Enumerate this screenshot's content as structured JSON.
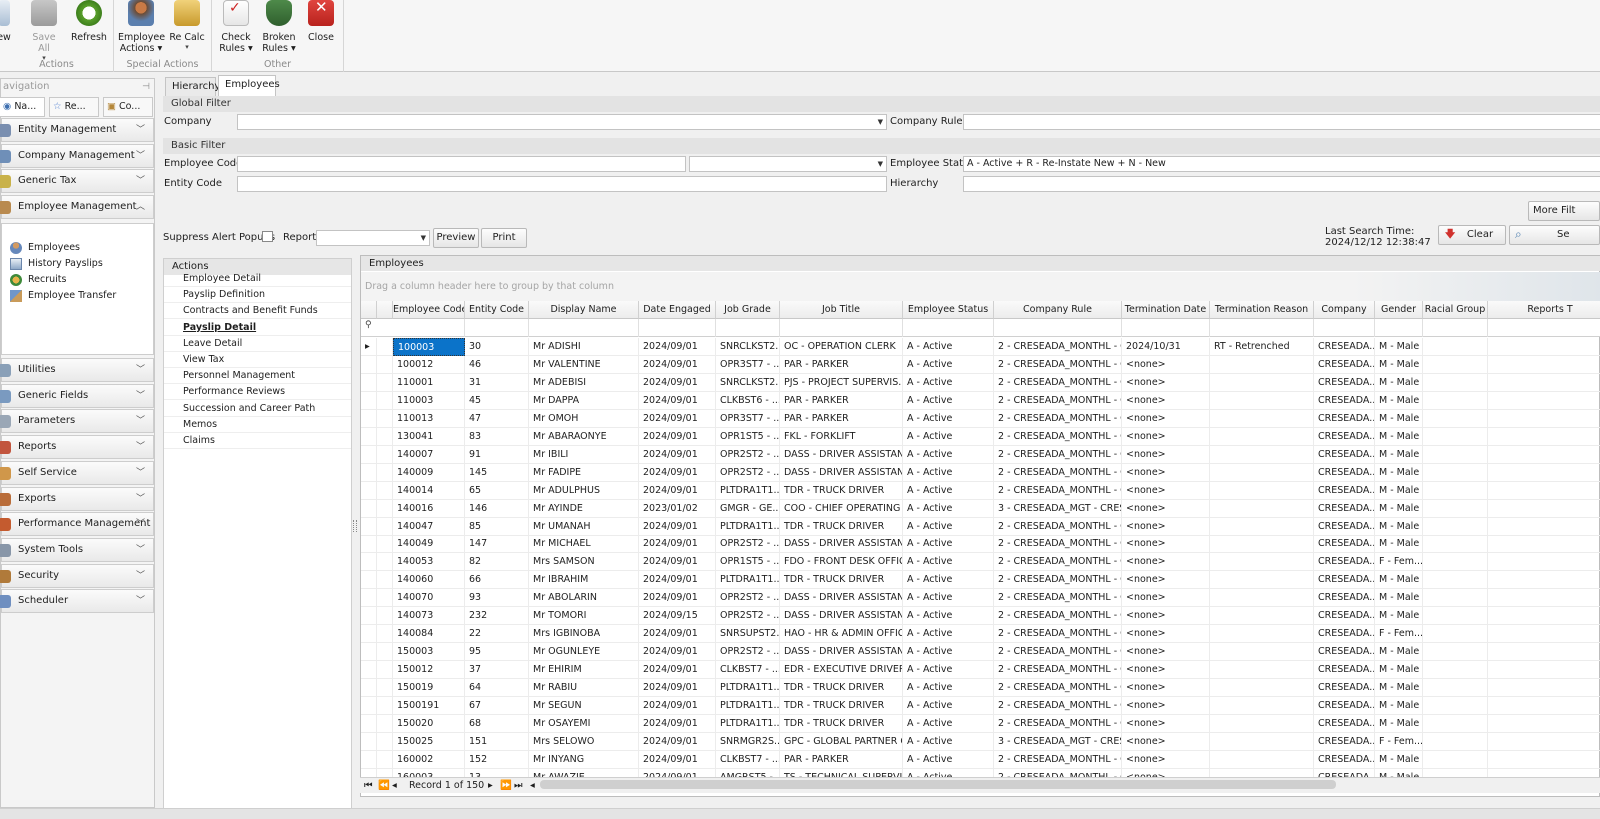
{
  "ribbon": {
    "groups": [
      {
        "caption": "Actions",
        "buttons": [
          {
            "label": "ew",
            "enabled": true
          },
          {
            "label": "Save All",
            "enabled": false
          },
          {
            "label": "Refresh",
            "enabled": true
          }
        ]
      },
      {
        "caption": "Special Actions",
        "buttons": [
          {
            "label": "Employee",
            "label2": "Actions",
            "dropdown": true
          },
          {
            "label": "Re Calc",
            "dropdown": true
          }
        ]
      },
      {
        "caption": "Other",
        "buttons": [
          {
            "label": "Check",
            "label2": "Rules",
            "dropdown": true
          },
          {
            "label": "Broken",
            "label2": "Rules",
            "dropdown": true
          },
          {
            "label": "Close"
          }
        ]
      }
    ]
  },
  "nav": {
    "title": "avigation",
    "pin": "ᵖ",
    "tabs": [
      "Na...",
      "Re...",
      "Co..."
    ],
    "sections_top": [
      "Entity Management",
      "Company Management",
      "Generic Tax",
      "Employee Management"
    ],
    "tree": [
      "Employees",
      "History Payslips",
      "Recruits",
      "Employee Transfer"
    ],
    "sections_bottom": [
      "Utilities",
      "Generic Fields",
      "Parameters",
      "Reports",
      "Self Service",
      "Exports",
      "Performance Management",
      "System Tools",
      "Security",
      "Scheduler"
    ]
  },
  "tabs": [
    "Hierarchy",
    "Employees"
  ],
  "filters": {
    "global_title": "Global Filter",
    "company_label": "Company",
    "company_rule_label": "Company Rule",
    "basic_title": "Basic Filter",
    "employee_code_label": "Employee Code",
    "employee_status_label": "Employee Status",
    "employee_status_value": "A - Active + R - Re-Instate New + N - New",
    "entity_code_label": "Entity Code",
    "hierarchy_label": "Hierarchy",
    "more_filters": "More Filt",
    "suppress_label": "Suppress Alert Popups",
    "report_label": "Report",
    "preview": "Preview",
    "print": "Print",
    "last_search_label": "Last Search Time:",
    "last_search_value": "2024/12/12 12:38:47",
    "clear": "Clear",
    "search": "Se"
  },
  "actions": {
    "title": "Actions",
    "items": [
      "Employee Detail",
      "Payslip Definition",
      "Contracts and Benefit Funds",
      "Payslip Detail",
      "Leave Detail",
      "View Tax",
      "Personnel Management",
      "Performance Reviews",
      "Succession and Career Path",
      "Memos",
      "Claims"
    ],
    "bold_index": 3
  },
  "grid": {
    "title": "Employees",
    "group_hint": "Drag a column header here to group by that column",
    "columns": [
      "Employee Code",
      "Entity Code",
      "Display Name",
      "Date Engaged",
      "Job Grade",
      "Job Title",
      "Employee Status",
      "Company Rule",
      "Termination Date",
      "Termination Reason",
      "Company",
      "Gender",
      "Racial Group",
      "Reports T"
    ],
    "rows": [
      [
        "100003",
        "30",
        "Mr ADISHI",
        "2024/09/01",
        "SNRCLKST2...",
        "OC - OPERATION CLERK",
        "A - Active",
        "2 - CRESEADA_MONTHL - C...",
        "2024/10/31",
        "RT - Retrenched",
        "CRESEADA...",
        "M - Male",
        "",
        ""
      ],
      [
        "100012",
        "46",
        "Mr VALENTINE",
        "2024/09/01",
        "OPR3ST7 - ...",
        "PAR - PARKER",
        "A - Active",
        "2 - CRESEADA_MONTHL - C...",
        "<none>",
        "",
        "CRESEADA...",
        "M - Male",
        "",
        ""
      ],
      [
        "110001",
        "31",
        "Mr ADEBISI",
        "2024/09/01",
        "SNRCLKST2...",
        "PJS - PROJECT SUPERVIS...",
        "A - Active",
        "2 - CRESEADA_MONTHL - C...",
        "<none>",
        "",
        "CRESEADA...",
        "M - Male",
        "",
        ""
      ],
      [
        "110003",
        "45",
        "Mr DAPPA",
        "2024/09/01",
        "CLKBST6 - ...",
        "PAR - PARKER",
        "A - Active",
        "2 - CRESEADA_MONTHL - C...",
        "<none>",
        "",
        "CRESEADA...",
        "M - Male",
        "",
        ""
      ],
      [
        "110013",
        "47",
        "Mr OMOH",
        "2024/09/01",
        "OPR3ST7 - ...",
        "PAR - PARKER",
        "A - Active",
        "2 - CRESEADA_MONTHL - C...",
        "<none>",
        "",
        "CRESEADA...",
        "M - Male",
        "",
        ""
      ],
      [
        "130041",
        "83",
        "Mr ABARAONYE",
        "2024/09/01",
        "OPR1ST5 - ...",
        "FKL - FORKLIFT",
        "A - Active",
        "2 - CRESEADA_MONTHL - C...",
        "<none>",
        "",
        "CRESEADA...",
        "M - Male",
        "",
        ""
      ],
      [
        "140007",
        "91",
        "Mr IBILI",
        "2024/09/01",
        "OPR2ST2 - ...",
        "DASS - DRIVER ASSISTANT",
        "A - Active",
        "2 - CRESEADA_MONTHL - C...",
        "<none>",
        "",
        "CRESEADA...",
        "M - Male",
        "",
        ""
      ],
      [
        "140009",
        "145",
        "Mr FADIPE",
        "2024/09/01",
        "OPR2ST2 - ...",
        "DASS - DRIVER ASSISTANT",
        "A - Active",
        "2 - CRESEADA_MONTHL - C...",
        "<none>",
        "",
        "CRESEADA...",
        "M - Male",
        "",
        ""
      ],
      [
        "140014",
        "65",
        "Mr ADULPHUS",
        "2024/09/01",
        "PLTDRA1T1...",
        "TDR - TRUCK DRIVER",
        "A - Active",
        "2 - CRESEADA_MONTHL - C...",
        "<none>",
        "",
        "CRESEADA...",
        "M - Male",
        "",
        ""
      ],
      [
        "140016",
        "146",
        "Mr AYINDE",
        "2023/01/02",
        "GMGR - GE...",
        "COO - CHIEF OPERATING ...",
        "A - Active",
        "3 - CRESEADA_MGT - CRES...",
        "<none>",
        "",
        "CRESEADA...",
        "M - Male",
        "",
        ""
      ],
      [
        "140047",
        "85",
        "Mr UMANAH",
        "2024/09/01",
        "PLTDRA1T1...",
        "TDR - TRUCK DRIVER",
        "A - Active",
        "2 - CRESEADA_MONTHL - C...",
        "<none>",
        "",
        "CRESEADA...",
        "M - Male",
        "",
        ""
      ],
      [
        "140049",
        "147",
        "Mr MICHAEL",
        "2024/09/01",
        "OPR2ST2 - ...",
        "DASS - DRIVER ASSISTANT",
        "A - Active",
        "2 - CRESEADA_MONTHL - C...",
        "<none>",
        "",
        "CRESEADA...",
        "M - Male",
        "",
        ""
      ],
      [
        "140053",
        "82",
        "Mrs SAMSON",
        "2024/09/01",
        "OPR1ST5 - ...",
        "FDO - FRONT DESK OFFIC...",
        "A - Active",
        "2 - CRESEADA_MONTHL - C...",
        "<none>",
        "",
        "CRESEADA...",
        "F - Fem...",
        "",
        ""
      ],
      [
        "140060",
        "66",
        "Mr IBRAHIM",
        "2024/09/01",
        "PLTDRA1T1...",
        "TDR - TRUCK DRIVER",
        "A - Active",
        "2 - CRESEADA_MONTHL - C...",
        "<none>",
        "",
        "CRESEADA...",
        "M - Male",
        "",
        ""
      ],
      [
        "140070",
        "93",
        "Mr ABOLARIN",
        "2024/09/01",
        "OPR2ST2 - ...",
        "DASS - DRIVER ASSISTANT",
        "A - Active",
        "2 - CRESEADA_MONTHL - C...",
        "<none>",
        "",
        "CRESEADA...",
        "M - Male",
        "",
        ""
      ],
      [
        "140073",
        "232",
        "Mr TOMORI",
        "2024/09/15",
        "OPR2ST2 - ...",
        "DASS - DRIVER ASSISTANT",
        "A - Active",
        "2 - CRESEADA_MONTHL - C...",
        "<none>",
        "",
        "CRESEADA...",
        "M - Male",
        "",
        ""
      ],
      [
        "140084",
        "22",
        "Mrs IGBINOBA",
        "2024/09/01",
        "SNRSUPST2...",
        "HAO - HR & ADMIN OFFIC...",
        "A - Active",
        "2 - CRESEADA_MONTHL - C...",
        "<none>",
        "",
        "CRESEADA...",
        "F - Fem...",
        "",
        ""
      ],
      [
        "150003",
        "95",
        "Mr OGUNLEYE",
        "2024/09/01",
        "OPR2ST2 - ...",
        "DASS - DRIVER ASSISTANT",
        "A - Active",
        "2 - CRESEADA_MONTHL - C...",
        "<none>",
        "",
        "CRESEADA...",
        "M - Male",
        "",
        ""
      ],
      [
        "150012",
        "37",
        "Mr EHIRIM",
        "2024/09/01",
        "CLKBST7 - ...",
        "EDR - EXECUTIVE DRIVER",
        "A - Active",
        "2 - CRESEADA_MONTHL - C...",
        "<none>",
        "",
        "CRESEADA...",
        "M - Male",
        "",
        ""
      ],
      [
        "150019",
        "64",
        "Mr RABIU",
        "2024/09/01",
        "PLTDRA1T1...",
        "TDR - TRUCK DRIVER",
        "A - Active",
        "2 - CRESEADA_MONTHL - C...",
        "<none>",
        "",
        "CRESEADA...",
        "M - Male",
        "",
        ""
      ],
      [
        "1500191",
        "67",
        "Mr SEGUN",
        "2024/09/01",
        "PLTDRA1T1...",
        "TDR - TRUCK DRIVER",
        "A - Active",
        "2 - CRESEADA_MONTHL - C...",
        "<none>",
        "",
        "CRESEADA...",
        "M - Male",
        "",
        ""
      ],
      [
        "150020",
        "68",
        "Mr OSAYEMI",
        "2024/09/01",
        "PLTDRA1T1...",
        "TDR - TRUCK DRIVER",
        "A - Active",
        "2 - CRESEADA_MONTHL - C...",
        "<none>",
        "",
        "CRESEADA...",
        "M - Male",
        "",
        ""
      ],
      [
        "150025",
        "151",
        "Mrs SELOWO",
        "2024/09/01",
        "SNRMGR2S...",
        "GPC - GLOBAL PARTNER C...",
        "A - Active",
        "3 - CRESEADA_MGT - CRES...",
        "<none>",
        "",
        "CRESEADA...",
        "F - Fem...",
        "",
        ""
      ],
      [
        "160002",
        "152",
        "Mr INYANG",
        "2024/09/01",
        "CLKBST7 - ...",
        "PAR - PARKER",
        "A - Active",
        "2 - CRESEADA_MONTHL - C...",
        "<none>",
        "",
        "CRESEADA...",
        "M - Male",
        "",
        ""
      ],
      [
        "160003",
        "13",
        "Mr AWAZIE",
        "2024/09/01",
        "AMGRST5 - ...",
        "TS - TECHNICAL SUPERVIS...",
        "A - Active",
        "2 - CRESEADA_MONTHL - C...",
        "<none>",
        "",
        "CRESEADA...",
        "M - Male",
        "",
        ""
      ]
    ],
    "record_text": "Record 1 of 150"
  },
  "colors": {
    "selection": "#0b73c9",
    "accent_red": "#d0312d"
  }
}
